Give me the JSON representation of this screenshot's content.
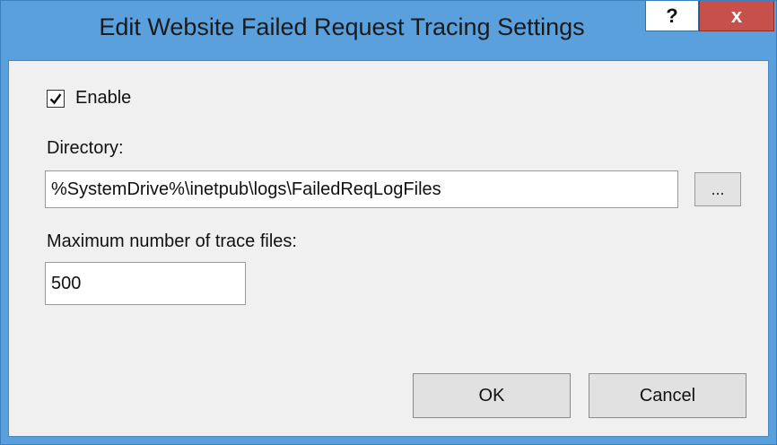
{
  "window": {
    "title": "Edit Website Failed Request Tracing Settings",
    "help_label": "?",
    "close_label": "x"
  },
  "form": {
    "enable_label": "Enable",
    "enable_checked": true,
    "directory_label": "Directory:",
    "directory_value": "%SystemDrive%\\inetpub\\logs\\FailedReqLogFiles",
    "browse_label": "...",
    "max_files_label": "Maximum number of trace files:",
    "max_files_value": "500"
  },
  "buttons": {
    "ok_label": "OK",
    "cancel_label": "Cancel"
  },
  "icons": {
    "checkbox": "checkmark-icon"
  },
  "colors": {
    "frame": "#5aa0dc",
    "close": "#c7504a",
    "client": "#f0f0f0"
  }
}
